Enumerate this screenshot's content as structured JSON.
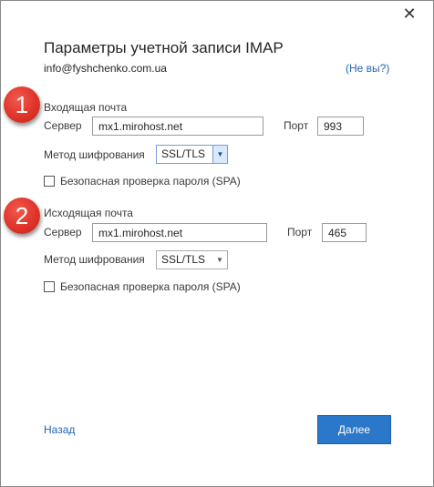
{
  "dialog": {
    "close_glyph": "✕",
    "title": "Параметры учетной записи IMAP",
    "email": "info@fyshchenko.com.ua",
    "not_you": "(Не вы?)"
  },
  "incoming": {
    "badge": "1",
    "heading": "Входящая почта",
    "server_label": "Сервер",
    "server_value": "mx1.mirohost.net",
    "port_label": "Порт",
    "port_value": "993",
    "encryption_label": "Метод шифрования",
    "encryption_value": "SSL/TLS",
    "spa_label": "Безопасная проверка пароля (SPA)",
    "spa_checked": false
  },
  "outgoing": {
    "badge": "2",
    "heading": "Исходящая почта",
    "server_label": "Сервер",
    "server_value": "mx1.mirohost.net",
    "port_label": "Порт",
    "port_value": "465",
    "encryption_label": "Метод шифрования",
    "encryption_value": "SSL/TLS",
    "spa_label": "Безопасная проверка пароля (SPA)",
    "spa_checked": false
  },
  "footer": {
    "back_label": "Назад",
    "next_label": "Далее"
  },
  "colors": {
    "accent": "#2b77c9",
    "link": "#1e66b4",
    "badge": "#e0342a"
  }
}
